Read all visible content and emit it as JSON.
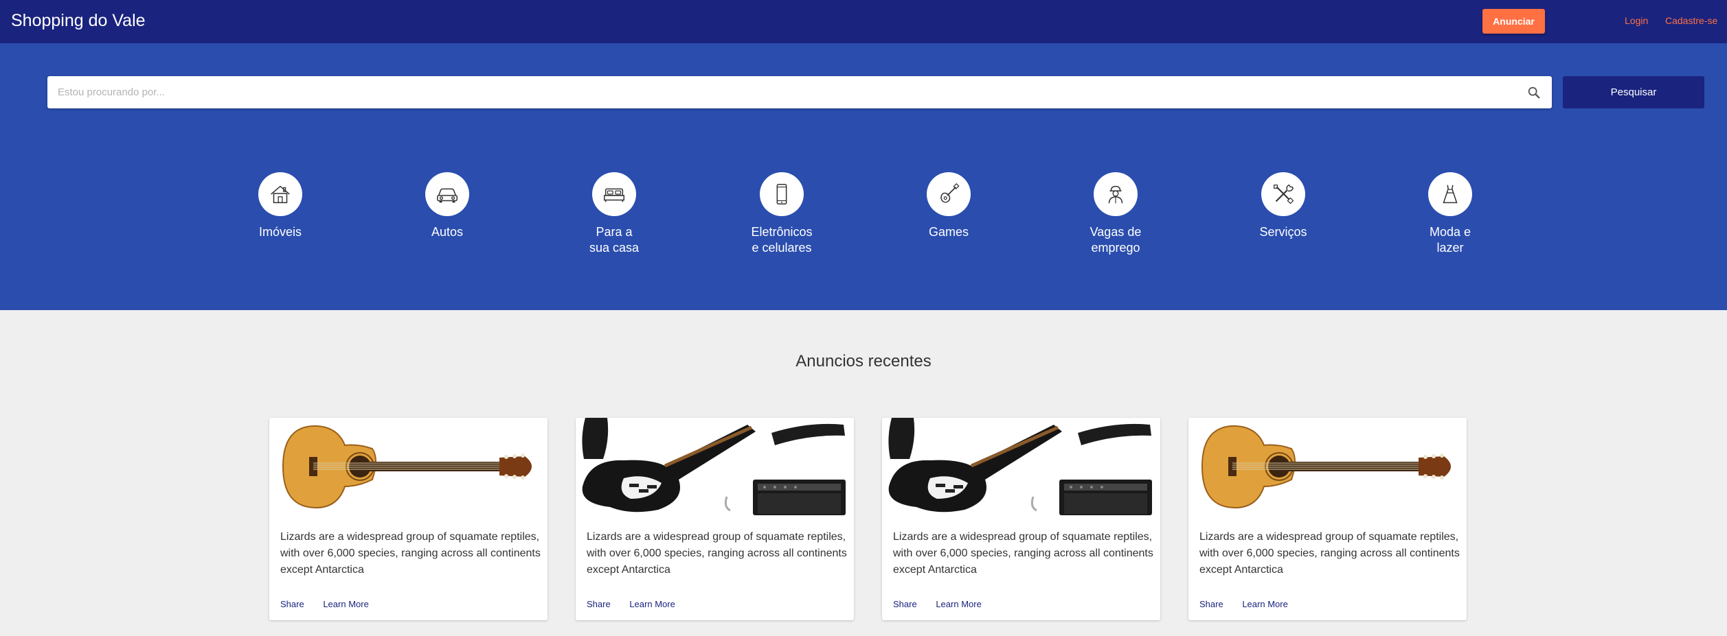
{
  "header": {
    "brand": "Shopping do Vale",
    "anunciar_label": "Anunciar",
    "login_label": "Login",
    "cadastre_label": "Cadastre-se"
  },
  "search": {
    "placeholder": "Estou procurando por...",
    "value": "",
    "button_label": "Pesquisar"
  },
  "categories": [
    {
      "label": "Imóveis",
      "icon": "house-icon"
    },
    {
      "label": "Autos",
      "icon": "car-icon"
    },
    {
      "label": "Para a\nsua casa",
      "icon": "bed-icon"
    },
    {
      "label": "Eletrônicos\ne celulares",
      "icon": "smartphone-icon"
    },
    {
      "label": "Games",
      "icon": "guitar-icon"
    },
    {
      "label": "Vagas de\nemprego",
      "icon": "worker-icon"
    },
    {
      "label": "Serviços",
      "icon": "tools-icon"
    },
    {
      "label": "Moda e\nlazer",
      "icon": "dress-icon"
    }
  ],
  "recent": {
    "title": "Anuncios recentes",
    "cards": [
      {
        "image": "acoustic-guitar",
        "description": "Lizards are a widespread group of squamate reptiles, with over 6,000 species, ranging across all continents except Antarctica",
        "share_label": "Share",
        "learn_label": "Learn More"
      },
      {
        "image": "electric-guitar-kit",
        "description": "Lizards are a widespread group of squamate reptiles, with over 6,000 species, ranging across all continents except Antarctica",
        "share_label": "Share",
        "learn_label": "Learn More"
      },
      {
        "image": "electric-guitar-kit",
        "description": "Lizards are a widespread group of squamate reptiles, with over 6,000 species, ranging across all continents except Antarctica",
        "share_label": "Share",
        "learn_label": "Learn More"
      },
      {
        "image": "acoustic-guitar",
        "description": "Lizards are a widespread group of squamate reptiles, with over 6,000 species, ranging across all continents except Antarctica",
        "share_label": "Share",
        "learn_label": "Learn More"
      }
    ]
  },
  "colors": {
    "header_bg": "#1a237e",
    "hero_bg": "#2a4dae",
    "accent": "#ff7043",
    "page_bg": "#efefef"
  }
}
